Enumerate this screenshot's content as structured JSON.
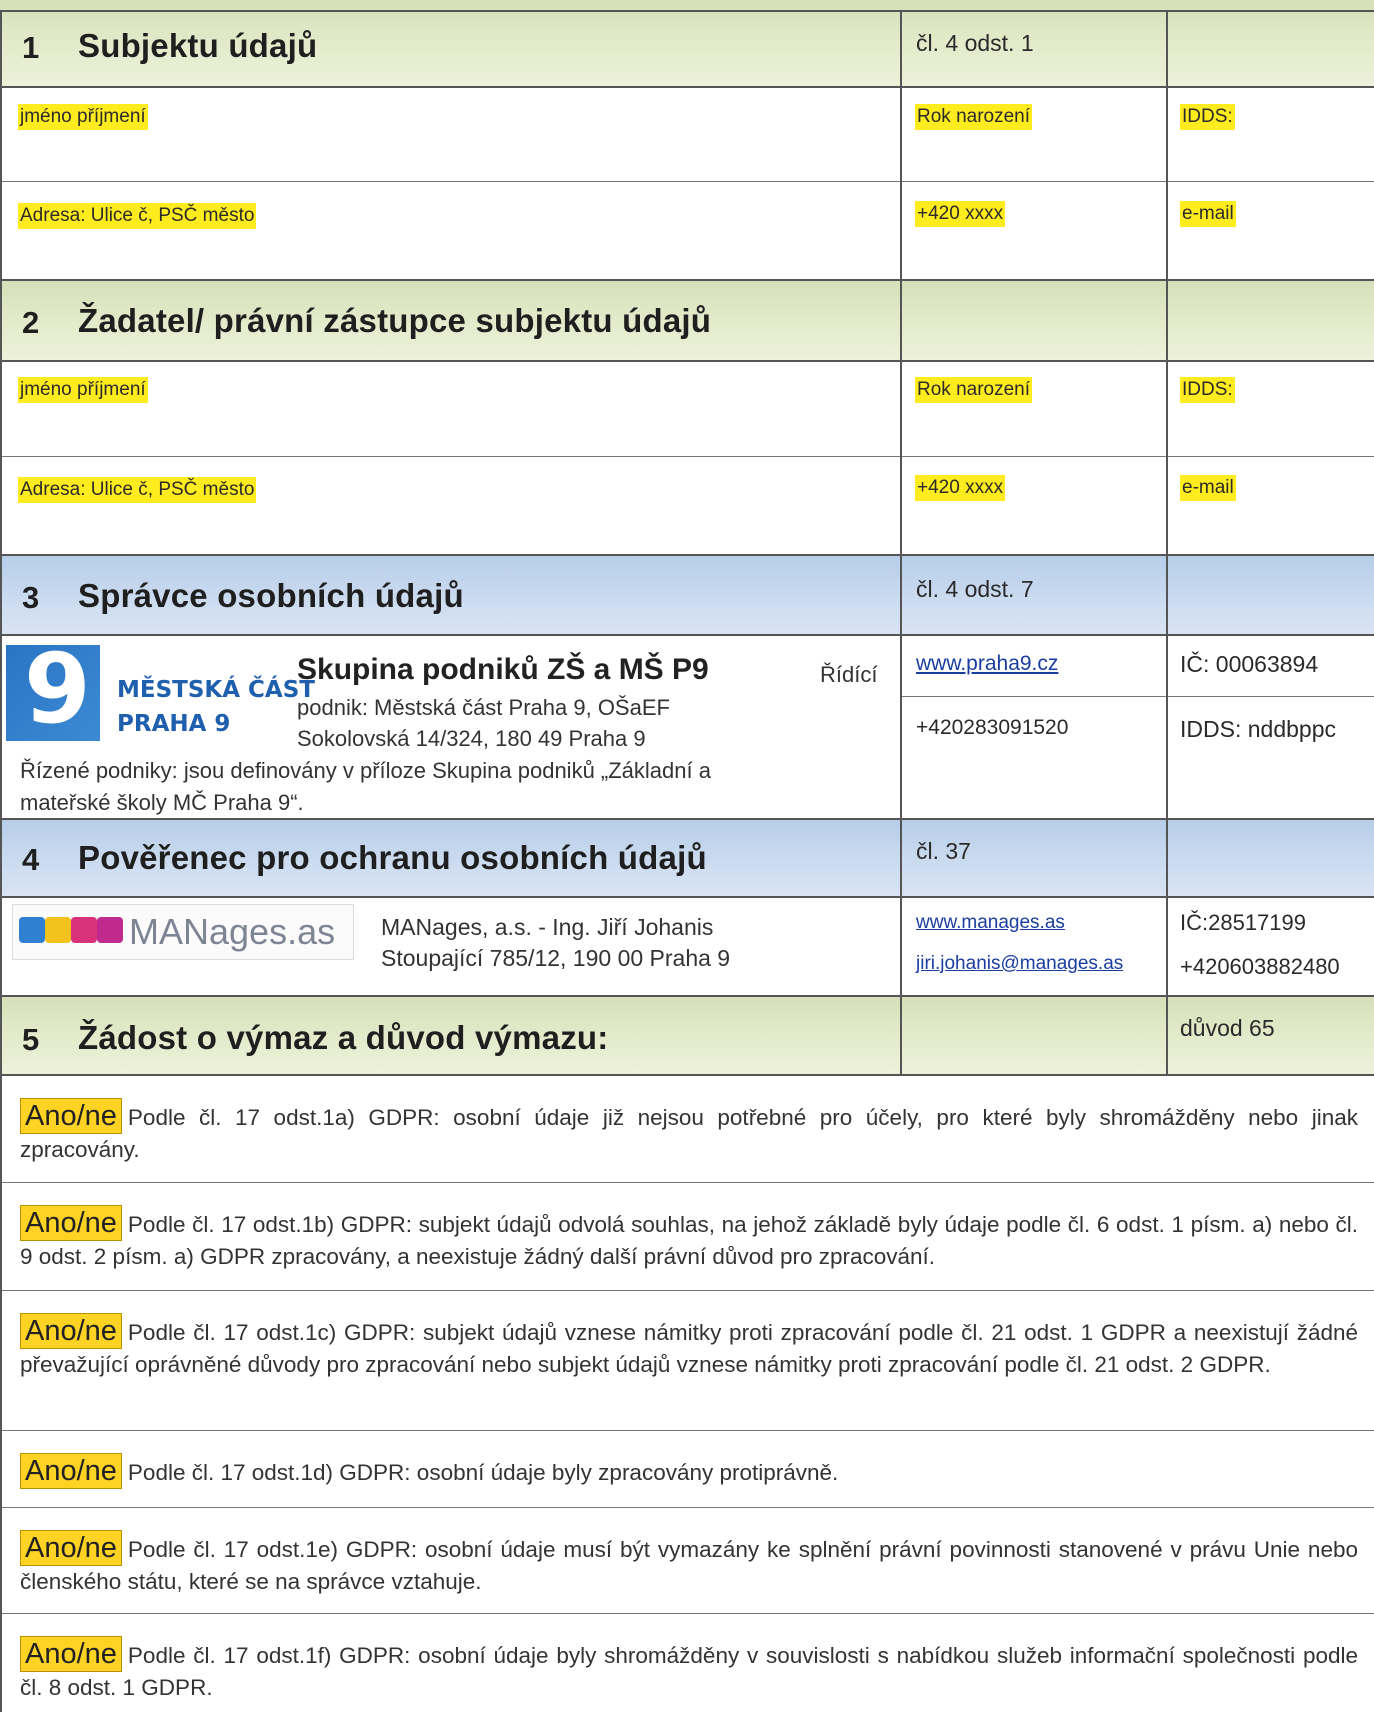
{
  "section1": {
    "number": "1",
    "title": "Subjektu údajů",
    "ref": "čl. 4 odst. 1",
    "name_label": "jméno příjmení",
    "birth_label": "Rok narození",
    "idds_label": "IDDS:",
    "address_label": "Adresa: Ulice č, PSČ město",
    "phone_label": "+420 xxxx",
    "email_label": "e-mail"
  },
  "section2": {
    "number": "2",
    "title": "Žadatel/ právní zástupce subjektu údajů",
    "name_label": "jméno příjmení",
    "birth_label": "Rok narození",
    "idds_label": "IDDS:",
    "address_label": "Adresa: Ulice č, PSČ město",
    "phone_label": "+420 xxxx",
    "email_label": "e-mail"
  },
  "section3": {
    "number": "3",
    "title": "Správce osobních údajů",
    "ref": "čl. 4 odst. 7",
    "logo_line1": "MĚSTSKÁ ČÁST",
    "logo_line2": "PRAHA 9",
    "org_name": "Skupina podniků ZŠ a MŠ P9",
    "org_desc_1": "Řídící",
    "org_desc_2": "podnik: Městská část Praha 9, OŠaEF",
    "org_desc_3": "Sokolovská 14/324, 180 49 Praha 9",
    "org_desc_4": "Řízené podniky: jsou definovány v příloze Skupina podniků „Základní a",
    "org_desc_5": "mateřské školy MČ Praha 9“.",
    "web": "www.praha9.cz",
    "phone": "+420283091520",
    "ic": "IČ: 00063894",
    "idds": "IDDS: nddbppc"
  },
  "section4": {
    "number": "4",
    "title": "Pověřenec pro ochranu osobních údajů",
    "ref": "čl. 37",
    "logo_text": "MANages.as",
    "person_line1": "MANages, a.s. - Ing. Jiří Johanis",
    "person_line2": "Stoupající 785/12, 190 00 Praha 9",
    "web": "www.manages.as",
    "email": "jiri.johanis@manages.as",
    "ic": "IČ:28517199",
    "phone": "+420603882480"
  },
  "section5": {
    "number": "5",
    "title": "Žádost o výmaz a důvod výmazu:",
    "ref": "důvod 65",
    "option_label": "Ano/ne",
    "items": [
      "Podle čl. 17 odst.1a) GDPR: osobní údaje již nejsou potřebné pro účely, pro které byly shromážděny nebo jinak zpracovány.",
      "Podle čl. 17 odst.1b) GDPR: subjekt údajů odvolá souhlas, na jehož základě byly údaje podle čl. 6 odst. 1 písm. a) nebo čl. 9 odst. 2 písm. a) GDPR zpracovány, a neexistuje žádný další právní důvod pro zpracování.",
      "Podle čl. 17 odst.1c) GDPR: subjekt údajů vznese námitky proti zpracování podle čl. 21 odst. 1 GDPR a neexistují žádné převažující oprávněné důvody pro zpracování nebo subjekt údajů vznese námitky proti zpracování podle čl. 21 odst. 2 GDPR.",
      "Podle čl. 17 odst.1d) GDPR: osobní údaje byly zpracovány protiprávně.",
      "Podle čl. 17 odst.1e) GDPR: osobní údaje musí být vymazány ke splnění právní povinnosti stanovené v právu Unie nebo členského státu, které se na správce vztahuje.",
      "Podle čl. 17 odst.1f) GDPR: osobní údaje byly shromážděny v souvislosti s nabídkou služeb informační společnosti podle čl. 8 odst. 1 GDPR."
    ]
  }
}
